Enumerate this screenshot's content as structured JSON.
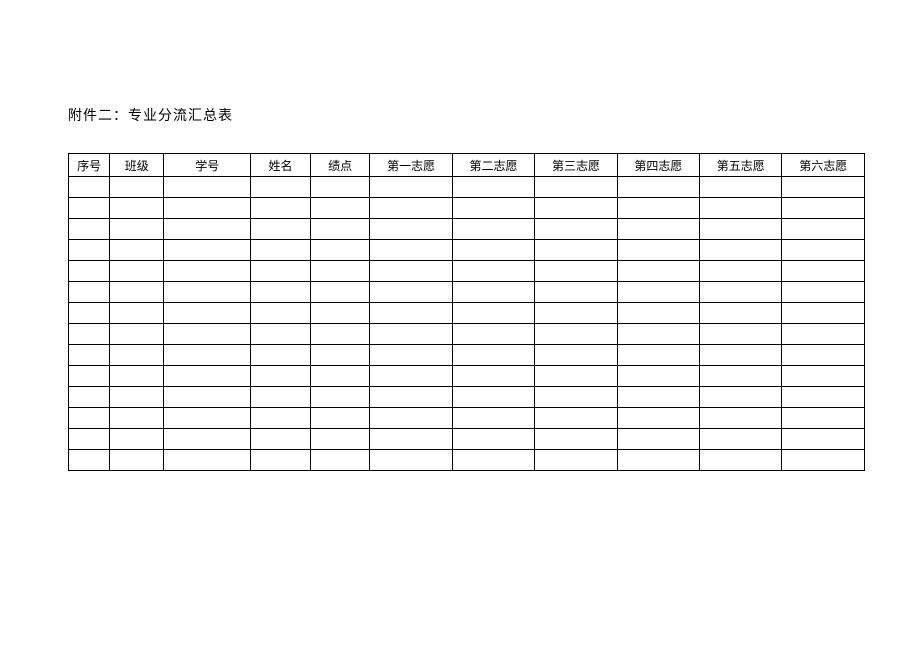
{
  "title": "附件二：专业分流汇总表",
  "chart_data": {
    "type": "table",
    "title": "专业分流汇总表",
    "headers": [
      "序号",
      "班级",
      "学号",
      "姓名",
      "绩点",
      "第一志愿",
      "第二志愿",
      "第三志愿",
      "第四志愿",
      "第五志愿",
      "第六志愿"
    ],
    "num_empty_rows": 14
  }
}
